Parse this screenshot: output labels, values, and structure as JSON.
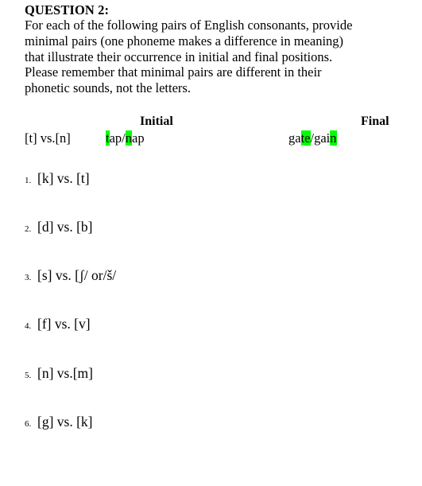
{
  "document": {
    "heading": "QUESTION 2:",
    "intro_lines": [
      "For each of the following pairs of English consonants, provide",
      "minimal pairs (one phoneme makes a difference in meaning)",
      "that illustrate their occurrence in initial and final positions.",
      "Please remember that minimal pairs are different in their",
      "phonetic sounds, not the letters."
    ],
    "columns": {
      "initial_label": "Initial",
      "final_label": "Final"
    },
    "highlight_color": "#00ff00",
    "example": {
      "pair_label": "[t] vs.[n]",
      "initial": {
        "prefix_a": "",
        "highlight_a": "t",
        "rest_a": "ap",
        "separator": "/",
        "prefix_b": "",
        "highlight_b": "n",
        "rest_b": "ap",
        "full_text": "tap/nap"
      },
      "final": {
        "prefix_a": "ga",
        "highlight_a": "te",
        "rest_a": "",
        "separator": "/",
        "prefix_b": "gai",
        "highlight_b": "n",
        "rest_b": "",
        "full_text": "gate/gain"
      }
    },
    "items": [
      {
        "number": "1.",
        "text": "[k] vs. [t]"
      },
      {
        "number": "2.",
        "text": "[d] vs. [b]"
      },
      {
        "number": "3.",
        "text": "[s] vs. [ʃ/ or/š/"
      },
      {
        "number": "4.",
        "text": "[f] vs. [v]"
      },
      {
        "number": "5.",
        "text": "[n] vs.[m]"
      },
      {
        "number": "6.",
        "text": "[g] vs. [k]"
      }
    ]
  }
}
